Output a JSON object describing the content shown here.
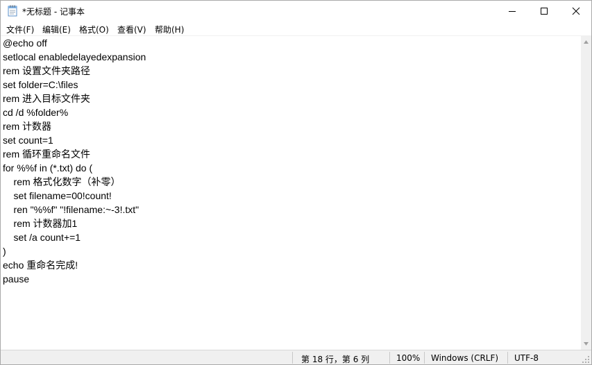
{
  "window": {
    "title": "*无标题 - 记事本",
    "icon": "notepad-icon"
  },
  "controls": {
    "minimize_icon": "minimize-icon",
    "maximize_icon": "maximize-icon",
    "close_icon": "close-icon"
  },
  "menu": {
    "items": [
      {
        "label": "文件(F)"
      },
      {
        "label": "编辑(E)"
      },
      {
        "label": "格式(O)"
      },
      {
        "label": "查看(V)"
      },
      {
        "label": "帮助(H)"
      }
    ]
  },
  "editor": {
    "lines": [
      "@echo off",
      "setlocal enabledelayedexpansion",
      "rem 设置文件夹路径",
      "set folder=C:\\files",
      "rem 进入目标文件夹",
      "cd /d %folder%",
      "rem 计数器",
      "set count=1",
      "rem 循环重命名文件",
      "for %%f in (*.txt) do (",
      "    rem 格式化数字（补零）",
      "    set filename=00!count!",
      "    ren \"%%f\" \"!filename:~-3!.txt\"",
      "    rem 计数器加1",
      "    set /a count+=1",
      ")",
      "echo 重命名完成!",
      "pause"
    ]
  },
  "status": {
    "position": "第 18 行，第 6 列",
    "zoom": "100%",
    "line_ending": "Windows (CRLF)",
    "encoding": "UTF-8"
  }
}
